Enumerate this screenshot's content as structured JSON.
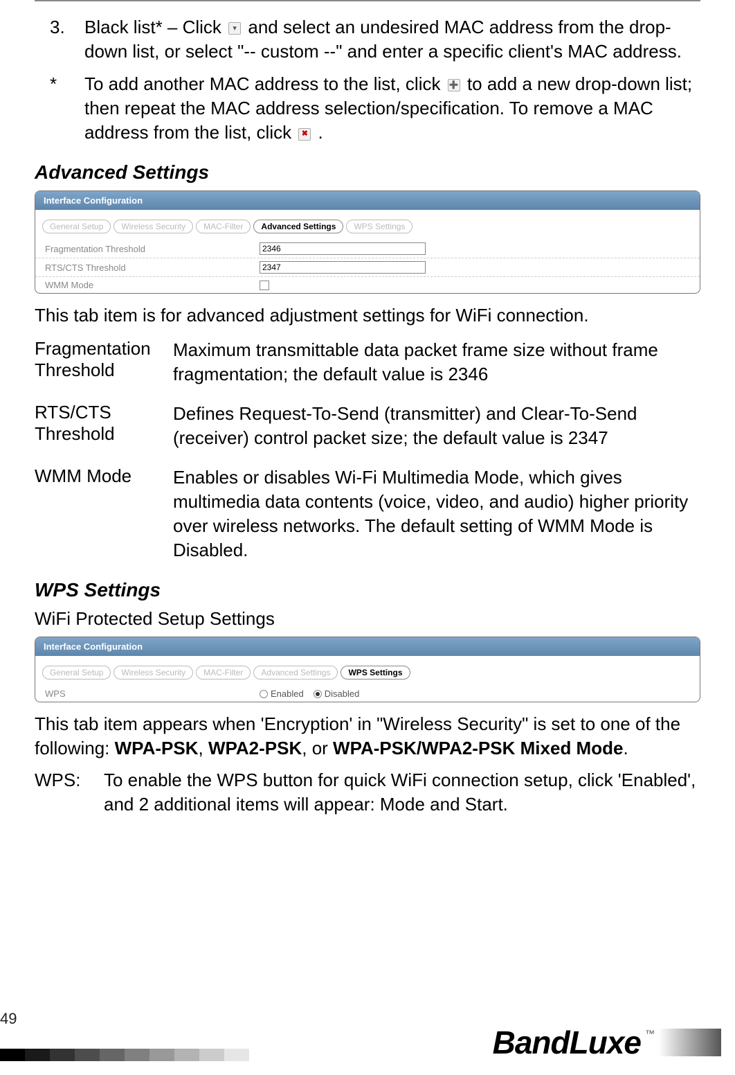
{
  "listItem3": {
    "num": "3.",
    "text_before_icon": "Black list* – Click ",
    "icon_name": "dropdown-icon",
    "text_after_icon": " and select an undesired MAC address from the drop-down list, or select \"-- custom --\" and enter a specific client's MAC address."
  },
  "footnote": {
    "marker": "*",
    "part1": "To add another MAC address to the list, click ",
    "icon1_name": "add-icon",
    "part2": " to add a new drop-down list; then repeat the MAC address selection/specification. To remove a MAC address from the list, click ",
    "icon2_name": "remove-icon",
    "part3": "."
  },
  "advanced": {
    "heading": "Advanced Settings",
    "panel_title": "Interface Configuration",
    "tabs": [
      "General Setup",
      "Wireless Security",
      "MAC-Filter",
      "Advanced Settings",
      "WPS Settings"
    ],
    "active_tab_index": 3,
    "rows": {
      "frag_label": "Fragmentation Threshold",
      "frag_value": "2346",
      "rts_label": "RTS/CTS Threshold",
      "rts_value": "2347",
      "wmm_label": "WMM Mode"
    },
    "caption": "This tab item is for advanced adjustment settings for WiFi connection.",
    "definitions": [
      {
        "term": "Fragmentation Threshold",
        "body": "Maximum transmittable data packet frame size without frame fragmentation; the default value is 2346"
      },
      {
        "term": "RTS/CTS Threshold",
        "body": "Defines Request-To-Send (transmitter) and Clear-To-Send (receiver) control packet size; the default value is 2347"
      },
      {
        "term": "WMM Mode",
        "body": "Enables or disables Wi-Fi Multimedia Mode, which gives multimedia data contents (voice, video, and audio) higher priority over wireless networks. The default setting of WMM Mode is Disabled."
      }
    ]
  },
  "wps": {
    "heading": "WPS Settings",
    "subhead": "WiFi Protected Setup Settings",
    "panel_title": "Interface Configuration",
    "tabs": [
      "General Setup",
      "Wireless Security",
      "MAC-Filter",
      "Advanced Settings",
      "WPS Settings"
    ],
    "active_tab_index": 4,
    "row_label": "WPS",
    "radio_enabled": "Enabled",
    "radio_disabled": "Disabled",
    "note_before_bold1": "This tab item appears when 'Encryption' in \"Wireless Security\" is set to one of the following: ",
    "bold1": "WPA-PSK",
    "sep1": ", ",
    "bold2": "WPA2-PSK",
    "sep2": ", or ",
    "bold3": "WPA-PSK/WPA2-PSK Mixed Mode",
    "note_after": ".",
    "def_term": "WPS:",
    "def_body": "To enable the WPS button for quick WiFi connection setup, click 'Enabled', and 2 additional items will appear: Mode and Start."
  },
  "footer": {
    "page": "49",
    "logo": "BandLuxe",
    "tm": "™",
    "grad_colors": [
      "#000000",
      "#1a1a1a",
      "#333333",
      "#4d4d4d",
      "#666666",
      "#808080",
      "#999999",
      "#b3b3b3",
      "#cccccc",
      "#e6e6e6"
    ]
  }
}
